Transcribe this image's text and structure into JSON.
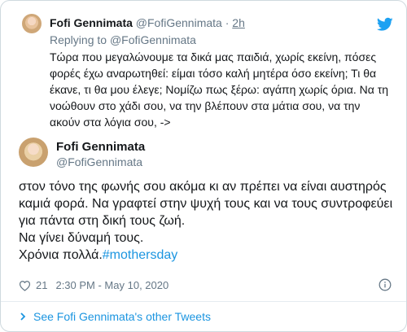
{
  "reply": {
    "name": "Fofi Gennimata",
    "handle": "@FofiGennimata",
    "dot": "·",
    "time": "2h",
    "replying_prefix": "Replying to ",
    "replying_handle": "@FofiGennimata",
    "text": "Τώρα που μεγαλώνουμε τα δικά μας παιδιά, χωρίς εκείνη, πόσες φορές έχω αναρωτηθεί: είμαι τόσο καλή μητέρα όσο εκείνη; Τι θα έκανε, τι θα μου έλεγε; Νομίζω πως ξέρω: αγάπη χωρίς όρια. Να τη νοώθουν στο χάδι σου, να την βλέπουν στα μάτια σου, να την ακούν στα λόγια σου, ->"
  },
  "tweet": {
    "name": "Fofi Gennimata",
    "handle": "@FofiGennimata",
    "line1": "στον τόνο της φωνής σου ακόμα κι αν πρέπει να είναι αυστηρός καμιά φορά. Να γραφτεί στην ψυχή τους και να τους συντροφεύει για πάντα στη δική τους ζωή.",
    "line2": "Να γίνει δύναμή τους.",
    "line3": "Χρόνια πολλά.",
    "hashtag": "#mothersday",
    "likes": "21",
    "timestamp": "2:30 PM - May 10, 2020"
  },
  "footer": {
    "see_more": "See Fofi Gennimata's other Tweets"
  },
  "icons": {
    "brand": "twitter-bird-icon",
    "like": "heart-icon",
    "info": "info-icon",
    "chevron": "chevron-right-icon"
  },
  "colors": {
    "brand_blue": "#1da1f2",
    "link_blue": "#1b95e0",
    "muted": "#657786",
    "text": "#14171a"
  }
}
